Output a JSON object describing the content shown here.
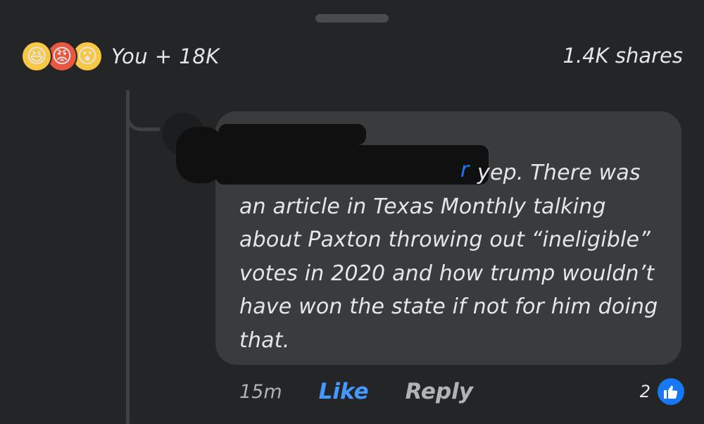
{
  "reactions": {
    "icons": [
      "haha-reaction-icon",
      "angry-reaction-icon",
      "wow-reaction-icon"
    ],
    "summary": "You + 18K"
  },
  "shares": "1.4K shares",
  "comment": {
    "author_visible_fragment": "r",
    "text": "yep. There was an article in Texas Monthly talking about Paxton throwing out “ineligible” votes in 2020 and how trump wouldn’t have won the state if not for him doing that."
  },
  "actions": {
    "time": "15m",
    "like_label": "Like",
    "reply_label": "Reply",
    "like_count": "2",
    "like_icon": "thumbs-up-icon"
  },
  "colors": {
    "background": "#242526",
    "bubble": "#3a3b3c",
    "accent": "#1877f2",
    "like_active": "#4599ff",
    "muted": "#b0b3b8"
  }
}
